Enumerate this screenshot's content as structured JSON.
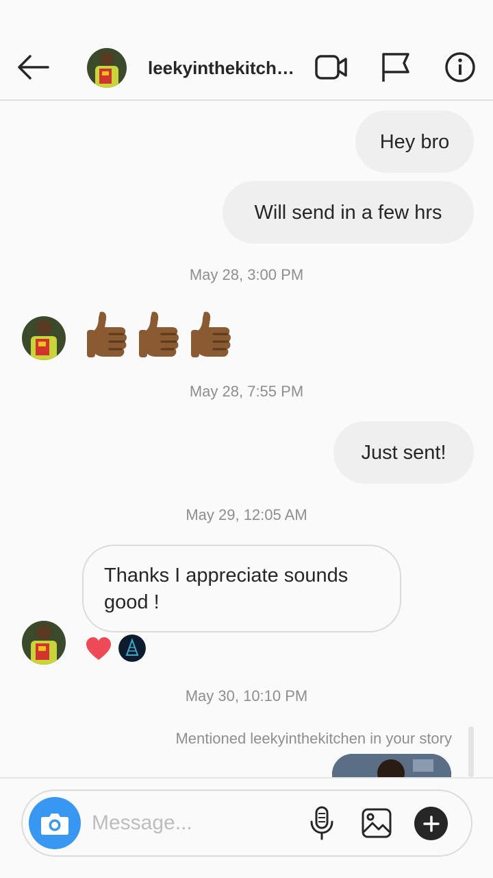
{
  "header": {
    "title": "leekyinthekitchen",
    "back_icon": "arrow-left-icon",
    "video_icon": "video-camera-icon",
    "flag_icon": "flag-icon",
    "info_icon": "info-icon"
  },
  "messages": {
    "out_1": "Hey bro",
    "out_2": "Will send in a few hrs",
    "ts_1": "May 28, 3:00 PM",
    "in_thumbs": "👍🏾👍🏾👍🏾",
    "ts_2": "May 28, 7:55 PM",
    "out_3": "Just sent!",
    "ts_3": "May 29, 12:05 AM",
    "in_text": "Thanks I appreciate sounds good !",
    "reaction": "❤️",
    "ts_4": "May 30, 10:10 PM",
    "mention_note": "Mentioned leekyinthekitchen in your story"
  },
  "composer": {
    "placeholder": "Message...",
    "camera_icon": "camera-icon",
    "mic_icon": "microphone-icon",
    "gallery_icon": "image-icon",
    "plus_icon": "plus-icon"
  },
  "colors": {
    "accent_blue": "#3897f0",
    "bubble_gray": "#efefef",
    "heart_red": "#ed4956"
  }
}
